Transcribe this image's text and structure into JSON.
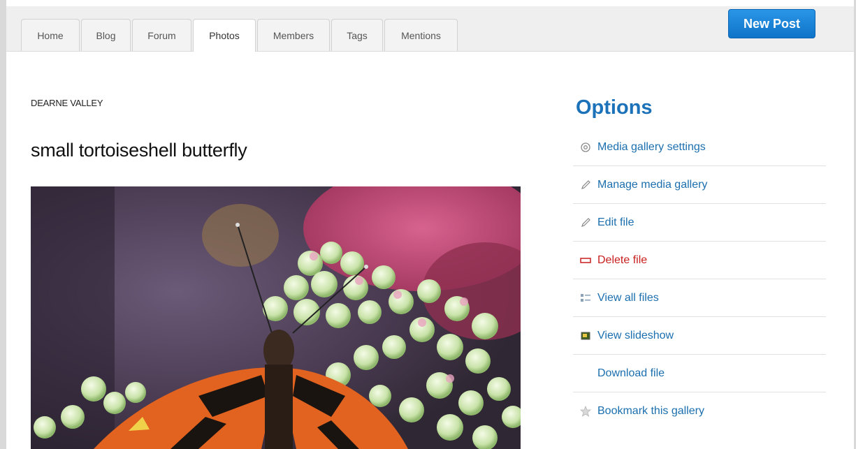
{
  "tabs": [
    {
      "label": "Home"
    },
    {
      "label": "Blog"
    },
    {
      "label": "Forum"
    },
    {
      "label": "Photos",
      "active": true
    },
    {
      "label": "Members"
    },
    {
      "label": "Tags"
    },
    {
      "label": "Mentions"
    }
  ],
  "header": {
    "new_post_label": "New Post"
  },
  "page": {
    "breadcrumb": "DEARNE VALLEY",
    "title": "small tortoiseshell butterfly"
  },
  "options": {
    "heading": "Options",
    "items": [
      {
        "label": "Media gallery settings",
        "icon": "gear-icon"
      },
      {
        "label": "Manage media gallery",
        "icon": "pencil-icon"
      },
      {
        "label": "Edit file",
        "icon": "pencil-icon"
      },
      {
        "label": "Delete file",
        "icon": "minus-icon"
      },
      {
        "label": "View all files",
        "icon": "list-icon"
      },
      {
        "label": "View slideshow",
        "icon": "slideshow-icon"
      },
      {
        "label": "Download file",
        "icon": "none"
      },
      {
        "label": "Bookmark this gallery",
        "icon": "star-icon"
      }
    ]
  },
  "colors": {
    "accent": "#1b72b8",
    "button": "#1a84d6",
    "danger": "#c81e1e"
  }
}
